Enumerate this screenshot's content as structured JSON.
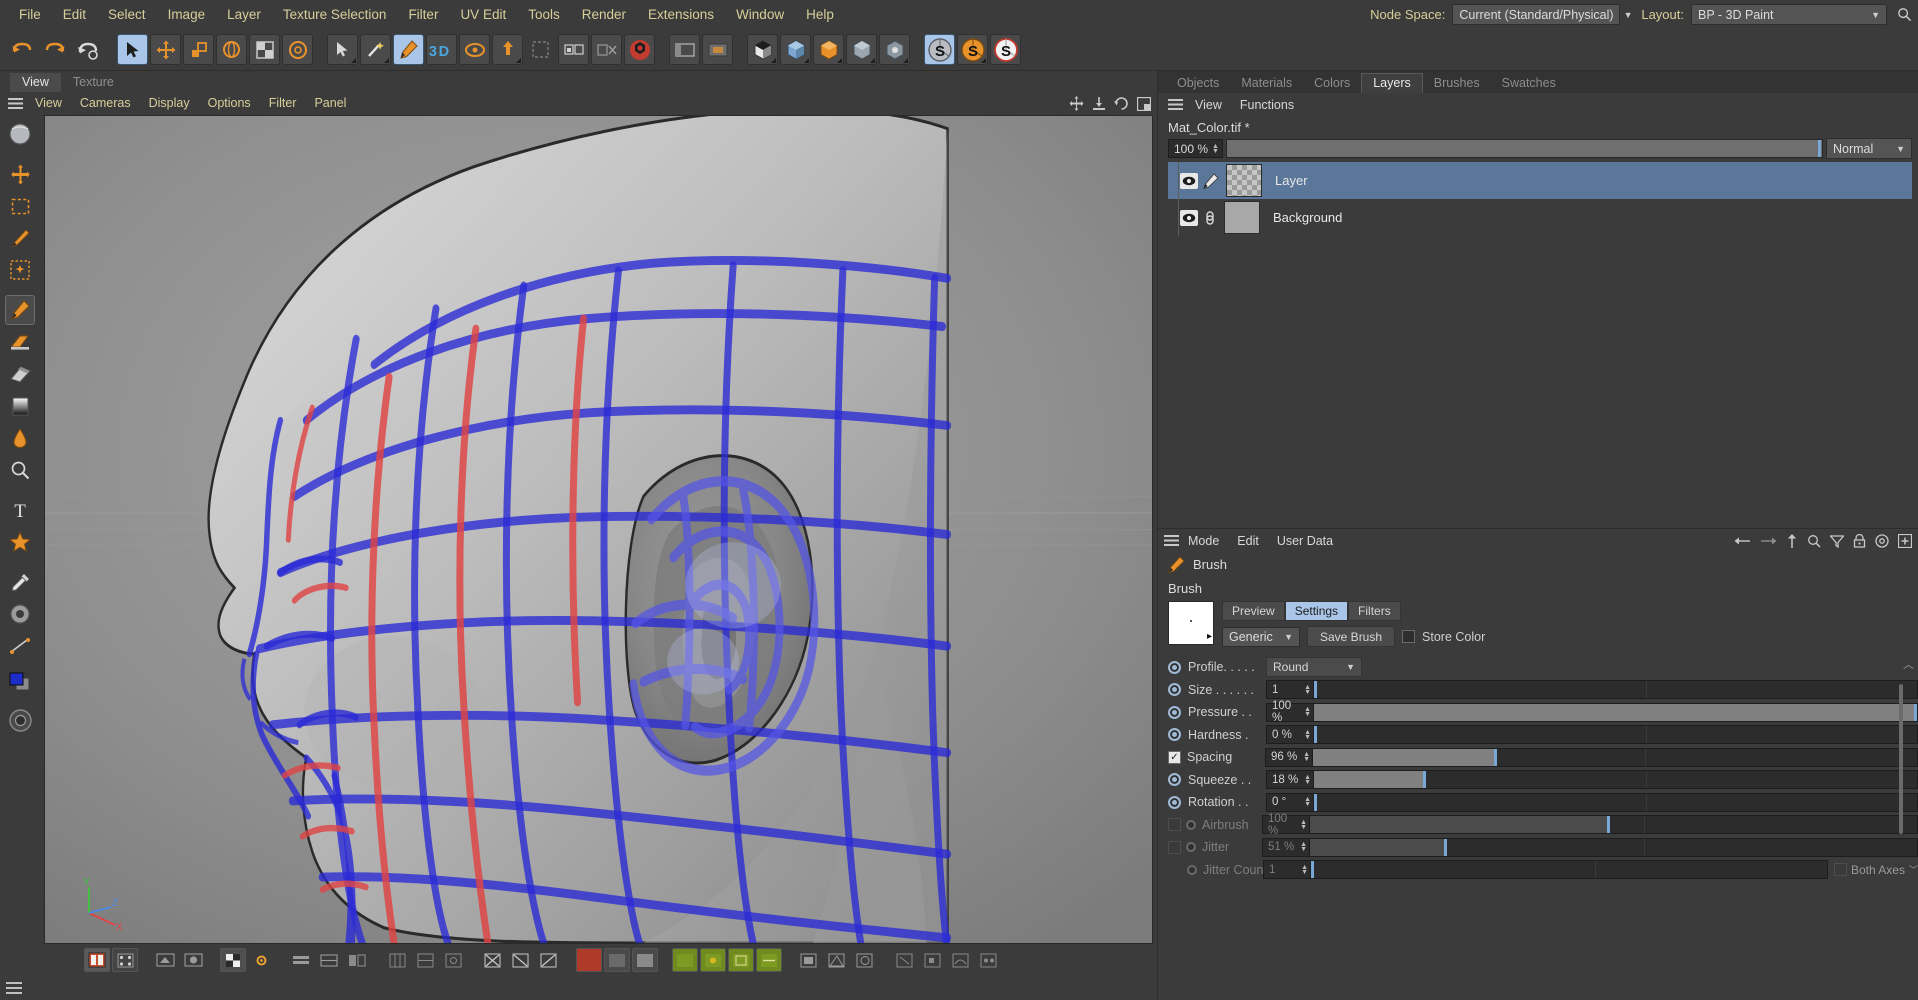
{
  "menubar": {
    "items": [
      "File",
      "Edit",
      "Select",
      "Image",
      "Layer",
      "Texture Selection",
      "Filter",
      "UV Edit",
      "Tools",
      "Render",
      "Extensions",
      "Window",
      "Help"
    ],
    "node_space_label": "Node Space:",
    "node_space_value": "Current (Standard/Physical)",
    "layout_label": "Layout:",
    "layout_value": "BP - 3D Paint",
    "search_icon": "search-icon"
  },
  "viewport": {
    "tabs": [
      {
        "label": "View",
        "active": true
      },
      {
        "label": "Texture",
        "active": false
      }
    ],
    "menu": [
      "View",
      "Cameras",
      "Display",
      "Options",
      "Filter",
      "Panel"
    ],
    "corner_icons": [
      "move-icon",
      "axis-icon",
      "rotate-icon",
      "layout-icon"
    ]
  },
  "right_panel": {
    "tabs": [
      {
        "label": "Objects",
        "active": false
      },
      {
        "label": "Materials",
        "active": false
      },
      {
        "label": "Colors",
        "active": false
      },
      {
        "label": "Layers",
        "active": true
      },
      {
        "label": "Brushes",
        "active": false
      },
      {
        "label": "Swatches",
        "active": false
      }
    ],
    "menu": [
      "View",
      "Functions"
    ],
    "texture_name": "Mat_Color.tif *",
    "opacity_value": "100 %",
    "blend_mode": "Normal",
    "layers": [
      {
        "name": "Layer",
        "selected": true,
        "visible": true,
        "thumb": "checker",
        "badge": "brush-icon"
      },
      {
        "name": "Background",
        "selected": false,
        "visible": true,
        "thumb": "flat",
        "badge": "link-icon"
      }
    ]
  },
  "attributes": {
    "menu": [
      "Mode",
      "Edit",
      "User Data"
    ],
    "toolbar_icons": [
      "back-arrow-icon",
      "forward-arrow-icon",
      "up-arrow-icon",
      "search-icon",
      "filter-icon",
      "lock-icon",
      "target-icon",
      "plus-icon"
    ],
    "object_name": "Brush",
    "object_icon": "brush-icon",
    "section_title": "Brush",
    "view_tabs": [
      {
        "label": "Preview",
        "active": false
      },
      {
        "label": "Settings",
        "active": true
      },
      {
        "label": "Filters",
        "active": false
      }
    ],
    "preset_value": "Generic",
    "save_brush_label": "Save Brush",
    "store_color_label": "Store Color",
    "store_color_checked": false,
    "parameters": [
      {
        "name": "Profile",
        "label": "Profile. . . . .",
        "type": "select",
        "value": "Round",
        "enabled": true,
        "radio": "ring"
      },
      {
        "name": "Size",
        "label": "Size  . . . . . .",
        "type": "slider",
        "value": "1",
        "fill_pct": 0,
        "enabled": true,
        "radio": "fill"
      },
      {
        "name": "Pressure",
        "label": "Pressure . .",
        "type": "slider",
        "value": "100 %",
        "fill_pct": 100,
        "enabled": true,
        "radio": "ring"
      },
      {
        "name": "Hardness",
        "label": "Hardness  .",
        "type": "slider",
        "value": "0 %",
        "fill_pct": 0,
        "enabled": true,
        "radio": "ring"
      },
      {
        "name": "Spacing",
        "label": "Spacing",
        "type": "slider",
        "value": "96 %",
        "fill_pct": 30,
        "enabled": true,
        "radio": "checkbox",
        "checked": true
      },
      {
        "name": "Squeeze",
        "label": "Squeeze . .",
        "type": "slider",
        "value": "18 %",
        "fill_pct": 18,
        "enabled": true,
        "radio": "ring"
      },
      {
        "name": "Rotation",
        "label": "Rotation . .",
        "type": "slider",
        "value": "0 °",
        "fill_pct": 0,
        "enabled": true,
        "radio": "ring"
      },
      {
        "name": "Airbrush",
        "label": "Airbrush",
        "type": "slider",
        "value": "100 %",
        "fill_pct": 49,
        "enabled": false,
        "radio": "checkbox-tiny",
        "checked": false
      },
      {
        "name": "Jitter",
        "label": "Jitter",
        "type": "slider",
        "value": "51 %",
        "fill_pct": 22,
        "enabled": false,
        "radio": "checkbox-tiny",
        "checked": false
      },
      {
        "name": "Jitter Count",
        "label": "Jitter Count",
        "type": "slider",
        "value": "1",
        "fill_pct": 0,
        "enabled": false,
        "radio": "tiny"
      }
    ],
    "both_axes_label": "Both Axes",
    "both_axes_checked": false
  },
  "colors": {
    "accent_blue": "#a9c6e8",
    "selection_blue": "#5a7699",
    "menu_yellow": "#d6cf9a",
    "panel_bg": "#3b3b3b",
    "field_bg": "#2c2c2c",
    "orange": "#e8922b",
    "wire_blue": "#2a2ad0",
    "wire_red": "#e04040"
  },
  "axis_gizmo": {
    "y": "Y",
    "x": "X",
    "z": "Z"
  }
}
